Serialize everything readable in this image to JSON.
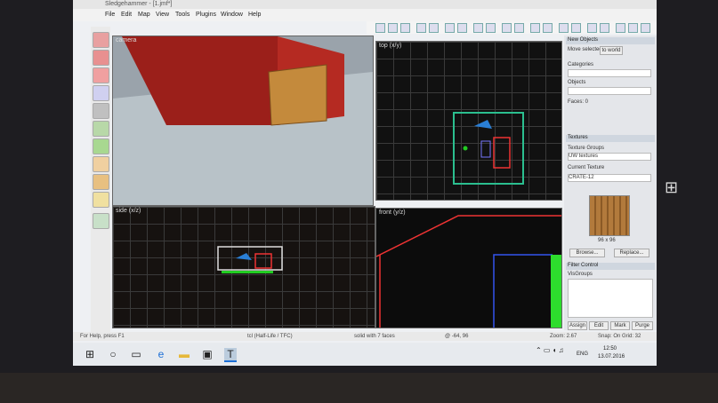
{
  "app": {
    "title": "Sledgehammer - [1.jmf*]"
  },
  "menu": [
    "File",
    "Edit",
    "Map",
    "View",
    "Tools",
    "Plugins",
    "Window",
    "Help"
  ],
  "viewports": {
    "camera": "camera",
    "top": "top (x/y)",
    "side": "side (x/z)",
    "front": "front (y/z)"
  },
  "panel": {
    "new_objects": "New Objects",
    "move_selected": "Move selected",
    "to_world": "to world",
    "categories": "Categories",
    "objects": "Objects",
    "faces": "Faces: 0",
    "textures": "Textures",
    "texture_groups": "Texture Groups",
    "group_value": "UW textures",
    "current_texture": "Current Texture",
    "texture_name": "CRATE-12",
    "texture_size": "96 x 96",
    "browse": "Browse...",
    "replace": "Replace...",
    "filter_control": "Filter Control",
    "visgroups": "VisGroups",
    "btn_assign": "Assign",
    "btn_edit": "Edit",
    "btn_mark": "Mark",
    "btn_purge": "Purge"
  },
  "status": {
    "help": "For Help, press F1",
    "game": "tcl (Half-Life / TFC)",
    "selection": "solid with 7 faces",
    "coords": "@ -64, 96",
    "zoom": "Zoom: 2.67",
    "snap": "Snap: On Grid: 32"
  },
  "taskbar": {
    "lang": "ENG",
    "time": "12:50",
    "date": "13.07.2016"
  },
  "icons": [
    "windows-start-icon",
    "search-icon",
    "task-view-icon",
    "edge-icon",
    "explorer-icon",
    "store-icon",
    "sledgehammer-icon"
  ]
}
